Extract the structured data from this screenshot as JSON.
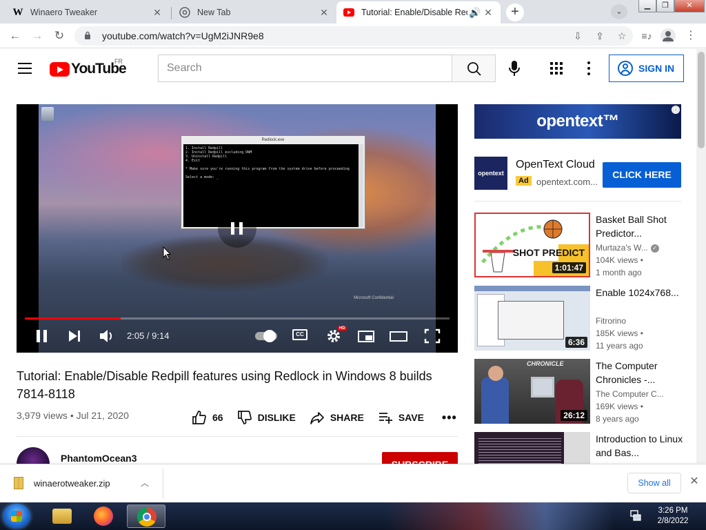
{
  "browser": {
    "tabs": [
      {
        "label": "Winaero Tweaker",
        "favicon": "W"
      },
      {
        "label": "New Tab"
      },
      {
        "label": "Tutorial: Enable/Disable Redp"
      }
    ],
    "url": "youtube.com/watch?v=UgM2iJNR9e8"
  },
  "youtube": {
    "logo_text": "YouTube",
    "country_code": "FR",
    "search_placeholder": "Search",
    "sign_in": "SIGN IN"
  },
  "player": {
    "elapsed": "2:05",
    "duration": "9:14",
    "time_display": "2:05 / 9:14",
    "progress": 0.226,
    "hd_badge": "HD",
    "cc_label": "CC",
    "cmd_window_title": "Redlock.exe",
    "cmd_text": "1. Install Redpill\n2. Install Redpill excluding DWM\n3. Uninstall Redpill\n4. Exit\n\n* Make sure you're running this program from the system drive before proceeding\n\nSelect a mode: _",
    "overlay_text": "Microsoft Confidential"
  },
  "ad": {
    "banner_text": "opentext™",
    "info_icon": "ⓘ",
    "logo_text": "opentext",
    "title": "OpenText Cloud",
    "badge": "Ad",
    "domain": "opentext.com...",
    "cta": "CLICK HERE"
  },
  "related": [
    {
      "title": "Basket Ball Shot Predictor...",
      "channel": "Murtaza's W...",
      "verified": true,
      "views": "104K views •",
      "age": "1 month ago",
      "duration": "1:01:47",
      "thumb_text": "SHOT PREDICT"
    },
    {
      "title": "Enable 1024x768...",
      "channel": "Fitrorino",
      "views": "185K views •",
      "age": "11 years ago",
      "duration": "6:36"
    },
    {
      "title": "The Computer Chronicles -...",
      "channel": "The Computer C...",
      "views": "169K views •",
      "age": "8 years ago",
      "duration": "26:12",
      "thumb_text": "CHRONICLE"
    },
    {
      "title": "Introduction to Linux and Bas..."
    }
  ],
  "video": {
    "title": "Tutorial: Enable/Disable Redpill features using Redlock in Windows 8 builds 7814-8118",
    "views": "3,979 views",
    "date": "Jul 21, 2020",
    "meta": "3,979 views • Jul 21, 2020",
    "likes": "66",
    "dislike": "DISLIKE",
    "share": "SHARE",
    "save": "SAVE",
    "channel": "PhantomOcean3",
    "subscribe": "SUBSCRIBE"
  },
  "download_bar": {
    "filename": "winaerotweaker.zip",
    "show_all": "Show all"
  },
  "taskbar": {
    "time": "3:26 PM",
    "date": "2/8/2022"
  },
  "colors": {
    "youtube_red": "#ff0000",
    "link_blue": "#065fd4",
    "ad_yellow": "#f9c93c"
  }
}
